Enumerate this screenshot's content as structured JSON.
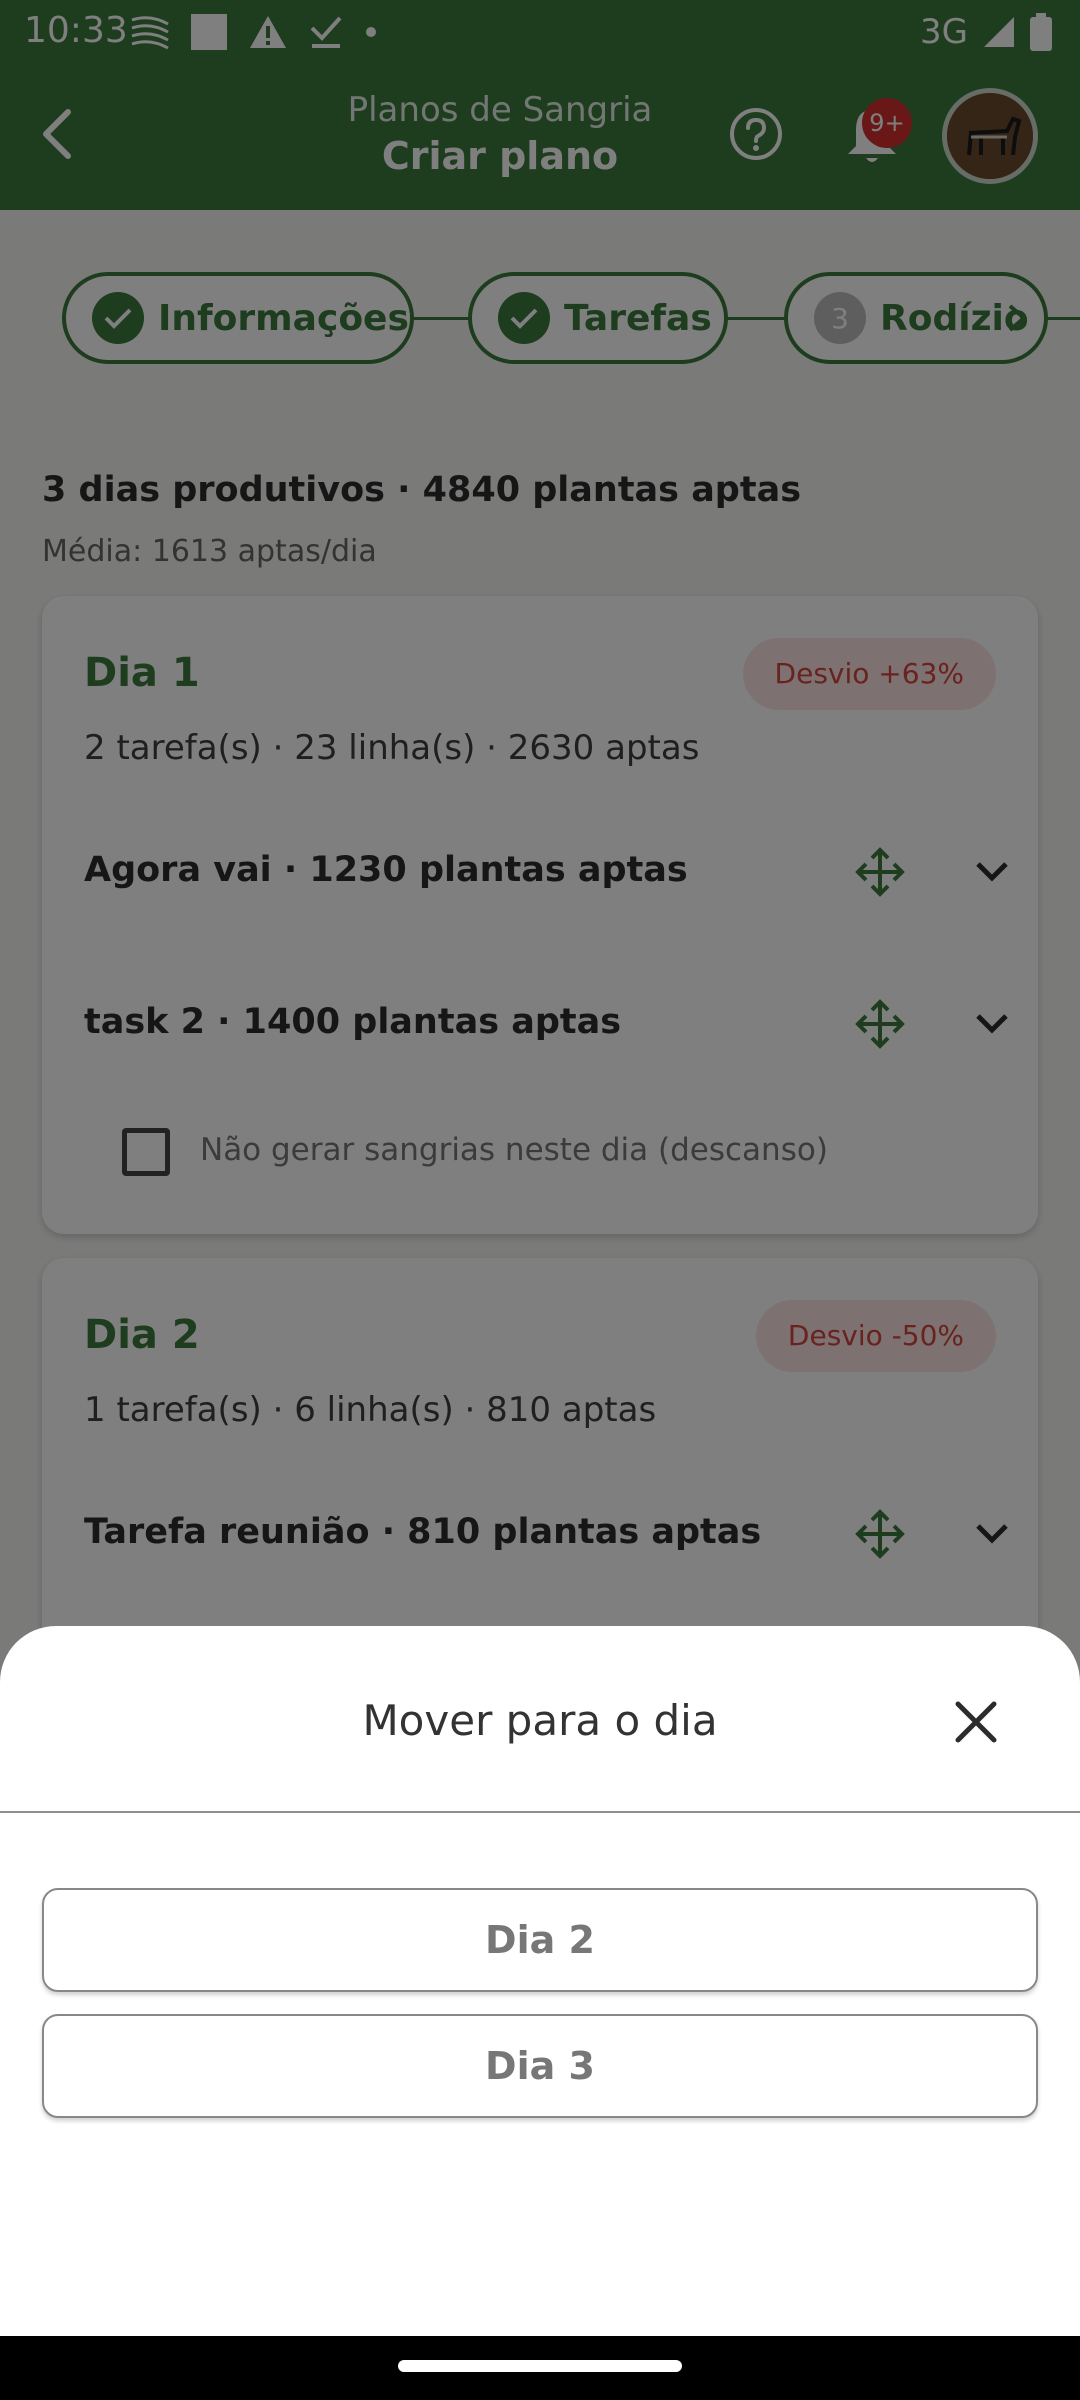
{
  "status_bar": {
    "time": "10:33",
    "network": "3G",
    "icons_left": [
      "signal-stripes-icon",
      "square-icon",
      "warning-icon",
      "download-done-icon",
      "dot-icon"
    ],
    "icons_right": [
      "cell-signal-icon",
      "battery-icon"
    ]
  },
  "app_bar": {
    "subtitle": "Planos de Sangria",
    "title": "Criar plano",
    "notification_badge": "9+",
    "back_icon": "chevron-left-icon",
    "help_icon": "help-circle-icon",
    "bell_icon": "bell-icon"
  },
  "stepper": {
    "steps": [
      {
        "label": "Informações",
        "state": "done"
      },
      {
        "label": "Tarefas",
        "state": "done"
      },
      {
        "number": "3",
        "label": "Rodízio",
        "state": "current"
      }
    ]
  },
  "summary": {
    "headline": "3 dias produtivos · 4840 plantas aptas",
    "average": "Média: 1613 aptas/dia"
  },
  "days": [
    {
      "title": "Dia 1",
      "deviation": "Desvio +63%",
      "meta": "2 tarefa(s) · 23 linha(s) · 2630 aptas",
      "tasks": [
        {
          "name": "Agora vai · 1230 plantas aptas"
        },
        {
          "name": "task 2 · 1400 plantas aptas"
        }
      ],
      "rest_label": "Não gerar sangrias neste dia (descanso)",
      "rest_checked": false
    },
    {
      "title": "Dia 2",
      "deviation": "Desvio -50%",
      "meta": "1 tarefa(s) · 6 linha(s) · 810 aptas",
      "tasks": [
        {
          "name": "Tarefa reunião · 810 plantas aptas"
        }
      ]
    }
  ],
  "sheet": {
    "title": "Mover para o dia",
    "options": [
      "Dia 2",
      "Dia 3"
    ]
  },
  "colors": {
    "primary": "#3a7a3c",
    "deviation_bg": "#fde3e3",
    "deviation_text": "#d0463f",
    "badge": "#d32f2f"
  }
}
